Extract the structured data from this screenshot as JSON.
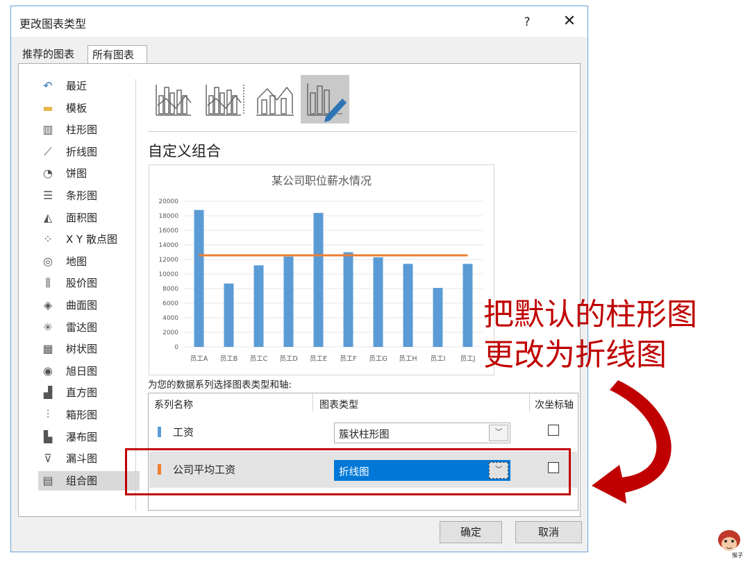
{
  "dialog": {
    "title": "更改图表类型",
    "help": "?",
    "close": "✕",
    "tabs": [
      "推荐的图表",
      "所有图表"
    ]
  },
  "sidebar": {
    "items": [
      {
        "label": "最近",
        "icon": "undo-icon"
      },
      {
        "label": "模板",
        "icon": "folder-icon"
      },
      {
        "label": "柱形图",
        "icon": "column-chart-icon"
      },
      {
        "label": "折线图",
        "icon": "line-chart-icon"
      },
      {
        "label": "饼图",
        "icon": "pie-chart-icon"
      },
      {
        "label": "条形图",
        "icon": "bar-chart-icon"
      },
      {
        "label": "面积图",
        "icon": "area-chart-icon"
      },
      {
        "label": "X Y 散点图",
        "icon": "scatter-chart-icon"
      },
      {
        "label": "地图",
        "icon": "map-chart-icon"
      },
      {
        "label": "股价图",
        "icon": "stock-chart-icon"
      },
      {
        "label": "曲面图",
        "icon": "surface-chart-icon"
      },
      {
        "label": "雷达图",
        "icon": "radar-chart-icon"
      },
      {
        "label": "树状图",
        "icon": "treemap-chart-icon"
      },
      {
        "label": "旭日图",
        "icon": "sunburst-chart-icon"
      },
      {
        "label": "直方图",
        "icon": "histogram-chart-icon"
      },
      {
        "label": "箱形图",
        "icon": "boxplot-chart-icon"
      },
      {
        "label": "瀑布图",
        "icon": "waterfall-chart-icon"
      },
      {
        "label": "漏斗图",
        "icon": "funnel-chart-icon"
      },
      {
        "label": "组合图",
        "icon": "combo-chart-icon"
      }
    ],
    "selected_index": 18
  },
  "main": {
    "section_title": "自定义组合",
    "series_prompt": "为您的数据系列选择图表类型和轴:",
    "table_headers": {
      "name": "系列名称",
      "type": "图表类型",
      "secondary": "次坐标轴"
    },
    "rows": [
      {
        "name": "工资",
        "type": "簇状柱形图",
        "color": "#5b9bd5",
        "secondary": false
      },
      {
        "name": "公司平均工资",
        "type": "折线图",
        "color": "#ed7d31",
        "secondary": false
      }
    ]
  },
  "buttons": {
    "ok": "确定",
    "cancel": "取消"
  },
  "annotation": {
    "line1": "把默认的柱形图",
    "line2": "更改为折线图",
    "color": "#c00000"
  },
  "logo_text": "猴子",
  "chart_data": {
    "type": "bar",
    "title": "某公司职位薪水情况",
    "categories": [
      "员工A",
      "员工B",
      "员工C",
      "员工D",
      "员工E",
      "员工F",
      "员工G",
      "员工H",
      "员工I",
      "员工J"
    ],
    "series": [
      {
        "type": "bar",
        "color": "#5b9bd5",
        "values": [
          18800,
          8700,
          11200,
          12400,
          18400,
          13000,
          12300,
          11400,
          8100,
          11400
        ]
      },
      {
        "type": "line",
        "color": "#ed7d31",
        "values": [
          12570,
          12570,
          12570,
          12570,
          12570,
          12570,
          12570,
          12570,
          12570,
          12570
        ]
      }
    ],
    "yticks": [
      "0",
      "2000",
      "4000",
      "6000",
      "8000",
      "10000",
      "12000",
      "14000",
      "16000",
      "18000",
      "20000"
    ],
    "ylim": [
      0,
      20000
    ],
    "grid": true
  }
}
